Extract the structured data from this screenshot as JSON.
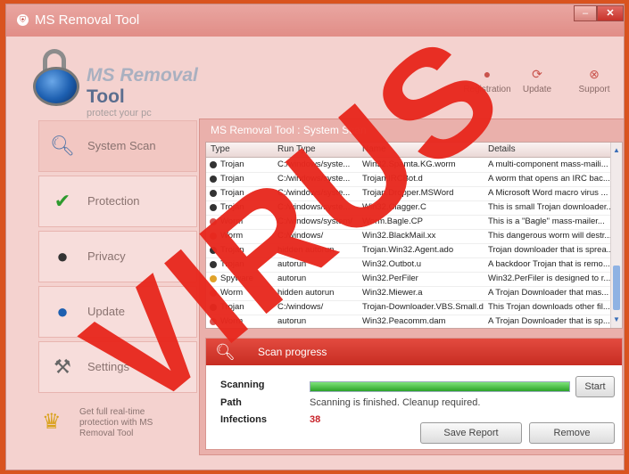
{
  "window": {
    "title": "MS Removal Tool",
    "title_icon": "shield-icon"
  },
  "brand": {
    "line1": "MS Removal",
    "line2": "Tool",
    "tagline": "protect your pc"
  },
  "topnav": [
    {
      "label": "Registration",
      "icon": "user-icon"
    },
    {
      "label": "Update",
      "icon": "refresh-icon"
    },
    {
      "label": "Support",
      "icon": "lifebuoy-icon"
    }
  ],
  "sidebar": [
    {
      "label": "System Scan",
      "icon": "magnifier-icon"
    },
    {
      "label": "Protection",
      "icon": "shield-check-icon"
    },
    {
      "label": "Privacy",
      "icon": "spy-icon"
    },
    {
      "label": "Update",
      "icon": "globe-icon"
    },
    {
      "label": "Settings",
      "icon": "wrench-icon"
    }
  ],
  "promo": {
    "text": "Get full real-time protection with MS Removal Tool",
    "icon": "trophy-icon"
  },
  "panel": {
    "title": "MS Removal Tool : System Scan"
  },
  "grid": {
    "headers": [
      "Type",
      "Run Type",
      "Name",
      "Details"
    ],
    "rows": [
      {
        "type": "Trojan",
        "run": "C:/windows/syste...",
        "name": "Win32.Spamta.KG.worm",
        "details": "A multi-component mass-maili..."
      },
      {
        "type": "Trojan",
        "run": "C:/windows/syste...",
        "name": "Trojan.IRCBot.d",
        "details": "A worm that opens an IRC bac..."
      },
      {
        "type": "Trojan",
        "run": "C:/windows/syste...",
        "name": "Trojan.Dropper.MSWord",
        "details": "A Microsoft Word macro virus ..."
      },
      {
        "type": "Trojan",
        "run": "C:/windows/syste...",
        "name": "Win32.Clagger.C",
        "details": "This is small Trojan downloader..."
      },
      {
        "type": "Worm",
        "run": "C:/windows/system/",
        "name": "Worm.Bagle.CP",
        "details": "This is a \"Bagle\" mass-mailer..."
      },
      {
        "type": "Worm",
        "run": "C:/windows/",
        "name": "Win32.BlackMail.xx",
        "details": "This dangerous worm will destr..."
      },
      {
        "type": "Trojan",
        "run": "hidden autorun",
        "name": "Trojan.Win32.Agent.ado",
        "details": "Trojan downloader that is sprea..."
      },
      {
        "type": "Trojan",
        "run": "autorun",
        "name": "Win32.Outbot.u",
        "details": "A backdoor Trojan that is remo..."
      },
      {
        "type": "Spyware",
        "run": "autorun",
        "name": "Win32.PerFiler",
        "details": "Win32.PerFiler is designed to r..."
      },
      {
        "type": "Worm",
        "run": "hidden autorun",
        "name": "Win32.Miewer.a",
        "details": "A Trojan Downloader that mas..."
      },
      {
        "type": "Trojan",
        "run": "C:/windows/",
        "name": "Trojan-Downloader.VBS.Small.dc",
        "details": "This Trojan downloads other fil..."
      },
      {
        "type": "Worm",
        "run": "autorun",
        "name": "Win32.Peacomm.dam",
        "details": "A Trojan Downloader that is sp..."
      }
    ]
  },
  "progress": {
    "header": "Scan progress",
    "scanning_label": "Scanning",
    "path_label": "Path",
    "path_value": "Scanning is finished. Cleanup required.",
    "infections_label": "Infections",
    "infections_value": "38",
    "percent": 100,
    "start_button": "Start",
    "save_button": "Save Report",
    "remove_button": "Remove"
  },
  "overlay": {
    "text": "VIRUS"
  },
  "colors": {
    "accent_red": "#e8281e",
    "progress_green": "#2ba228"
  }
}
